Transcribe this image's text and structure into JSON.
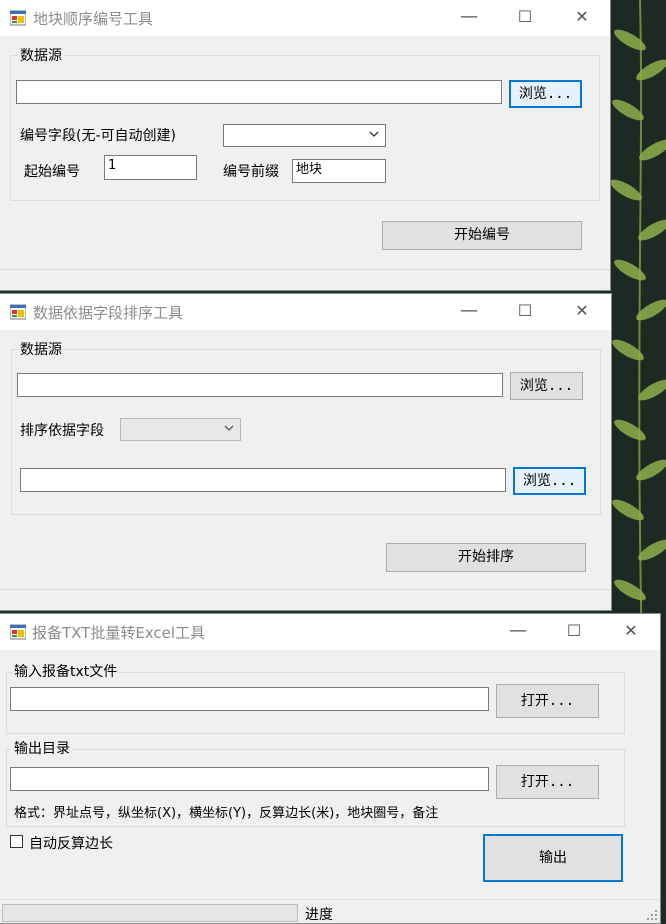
{
  "windows": {
    "numbering": {
      "title": "地块顺序编号工具",
      "group_label": "数据源",
      "browse_label": "浏览...",
      "field_label": "编号字段(无-可自动创建)",
      "start_label": "起始编号",
      "start_value": "1",
      "prefix_label": "编号前缀",
      "prefix_value": "地块",
      "start_button": "开始编号"
    },
    "sorting": {
      "title": "数据依据字段排序工具",
      "group_label": "数据源",
      "browse_label_1": "浏览...",
      "sort_field_label": "排序依据字段",
      "browse_label_2": "浏览...",
      "start_button": "开始排序"
    },
    "converter": {
      "title": "报备TXT批量转Excel工具",
      "input_group_label": "输入报备txt文件",
      "open_label_1": "打开...",
      "output_group_label": "输出目录",
      "open_label_2": "打开...",
      "format_text": "格式：界址点号，纵坐标(X)，横坐标(Y)，反算边长(米)，地块圈号，备注",
      "auto_calc_label": "自动反算边长",
      "output_button": "输出",
      "progress_label": "进度",
      "progress_value": 0
    }
  },
  "titlebar_controls": {
    "minimize": "—",
    "maximize": "☐",
    "close": "✕"
  },
  "icons": {
    "app": "app-window-icon",
    "dropdown": "chevron-down-icon"
  },
  "colors": {
    "focus_border": "#0078d7",
    "window_bg": "#f0f0f0",
    "title_text": "#8c8c8c"
  }
}
